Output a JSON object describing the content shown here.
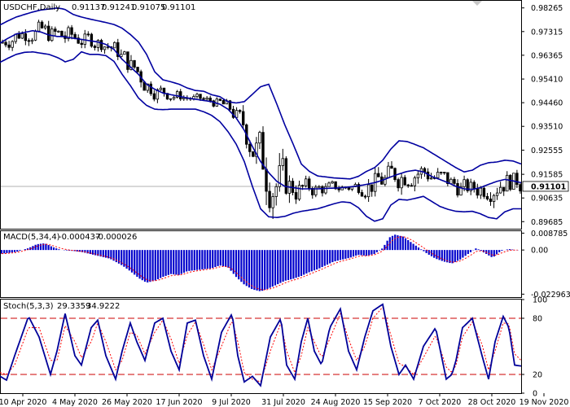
{
  "chart_data": {
    "type": "candlestick",
    "symbol_header": "USDCHF,Daily",
    "ohlc_header": [
      "0.91137",
      "0.91241",
      "0.91075",
      "0.91101"
    ],
    "current_price": "0.91101",
    "price_axis": {
      "ticks": [
        "0.98265",
        "0.97315",
        "0.96365",
        "0.95410",
        "0.94460",
        "0.93510",
        "0.92555",
        "0.91585",
        "0.90635",
        "0.89685"
      ],
      "ylim": [
        0.894,
        0.9855
      ]
    },
    "x_tick_labels": [
      "10 Apr 2020",
      "4 May 2020",
      "26 May 2020",
      "17 Jun 2020",
      "9 Jul 2020",
      "31 Jul 2020",
      "24 Aug 2020",
      "15 Sep 2020",
      "7 Oct 2020",
      "28 Oct 2020",
      "19 Nov 2020"
    ],
    "bollinger_anchors": {
      "x": [
        0,
        10,
        20,
        30,
        40,
        50,
        60,
        70,
        75,
        80,
        90,
        100,
        110,
        120,
        130,
        140,
        150,
        160,
        170,
        180,
        190,
        200,
        210,
        220,
        230,
        240,
        250,
        260,
        270,
        280,
        290,
        300,
        310,
        320,
        330,
        340,
        350,
        360,
        370,
        380,
        390,
        400,
        410,
        420,
        430,
        440,
        450,
        460,
        470,
        480,
        490,
        500,
        510,
        520,
        530,
        540,
        550,
        560,
        570,
        580,
        590,
        600,
        610,
        620,
        630,
        640
      ],
      "middle": [
        0.9685,
        0.9705,
        0.9722,
        0.9728,
        0.9735,
        0.973,
        0.9718,
        0.9712,
        0.9712,
        0.971,
        0.9705,
        0.97,
        0.9695,
        0.969,
        0.968,
        0.966,
        0.962,
        0.959,
        0.956,
        0.952,
        0.95,
        0.9485,
        0.9478,
        0.9472,
        0.9465,
        0.946,
        0.9455,
        0.945,
        0.944,
        0.942,
        0.9385,
        0.9335,
        0.927,
        0.921,
        0.9165,
        0.913,
        0.911,
        0.9105,
        0.91,
        0.91,
        0.91,
        0.9102,
        0.9103,
        0.9105,
        0.9108,
        0.9112,
        0.9118,
        0.9125,
        0.9135,
        0.9148,
        0.916,
        0.917,
        0.9175,
        0.9168,
        0.915,
        0.9138,
        0.9125,
        0.911,
        0.91,
        0.9098,
        0.9105,
        0.9118,
        0.913,
        0.9138,
        0.9132,
        0.9125
      ],
      "upper": [
        0.9758,
        0.9775,
        0.979,
        0.98,
        0.981,
        0.9818,
        0.9822,
        0.9826,
        0.9824,
        0.982,
        0.98,
        0.979,
        0.9782,
        0.9775,
        0.9768,
        0.976,
        0.9745,
        0.972,
        0.969,
        0.964,
        0.957,
        0.9538,
        0.953,
        0.952,
        0.9505,
        0.9495,
        0.9492,
        0.9478,
        0.947,
        0.945,
        0.9445,
        0.945,
        0.948,
        0.951,
        0.952,
        0.944,
        0.9355,
        0.928,
        0.92,
        0.917,
        0.9152,
        0.9148,
        0.9144,
        0.9142,
        0.914,
        0.915,
        0.917,
        0.9185,
        0.9215,
        0.926,
        0.9293,
        0.929,
        0.9278,
        0.9265,
        0.9245,
        0.9225,
        0.9205,
        0.9185,
        0.9168,
        0.9175,
        0.9195,
        0.9205,
        0.9208,
        0.9215,
        0.9212,
        0.92
      ],
      "lower": [
        0.9608,
        0.9625,
        0.964,
        0.9648,
        0.965,
        0.9645,
        0.964,
        0.9628,
        0.962,
        0.961,
        0.962,
        0.965,
        0.964,
        0.964,
        0.9635,
        0.9612,
        0.956,
        0.9515,
        0.9465,
        0.9435,
        0.942,
        0.9418,
        0.942,
        0.942,
        0.942,
        0.942,
        0.941,
        0.9395,
        0.937,
        0.933,
        0.928,
        0.921,
        0.911,
        0.902,
        0.8988,
        0.8985,
        0.899,
        0.9002,
        0.901,
        0.9015,
        0.902,
        0.903,
        0.904,
        0.9048,
        0.9045,
        0.9025,
        0.899,
        0.897,
        0.898,
        0.9035,
        0.9058,
        0.9055,
        0.9062,
        0.907,
        0.905,
        0.903,
        0.9018,
        0.901,
        0.9008,
        0.901,
        0.9,
        0.8985,
        0.898,
        0.9008,
        0.902,
        0.902
      ]
    },
    "macd": {
      "label": "MACD(5,34,4)",
      "main_value": "-0.000437",
      "signal_value": "-0.000026",
      "ticks": [
        "0.008785",
        "0.00",
        "-0.022963"
      ],
      "ylim": [
        -0.0245,
        0.0098
      ],
      "anchors_x": [
        0,
        20,
        35,
        45,
        55,
        65,
        75,
        90,
        100,
        110,
        120,
        135,
        150,
        160,
        170,
        180,
        190,
        200,
        210,
        220,
        230,
        240,
        250,
        260,
        270,
        280,
        290,
        300,
        310,
        320,
        330,
        340,
        350,
        360,
        370,
        380,
        390,
        400,
        410,
        420,
        430,
        440,
        450,
        460,
        470,
        478,
        485,
        495,
        505,
        515,
        525,
        535,
        545,
        555,
        565,
        575,
        585,
        595,
        605,
        615,
        625,
        640
      ],
      "anchors_y": [
        -0.002,
        -0.001,
        0.001,
        0.003,
        0.0035,
        0.0015,
        0.0,
        -0.0005,
        -0.001,
        -0.002,
        -0.003,
        -0.0045,
        -0.008,
        -0.011,
        -0.0145,
        -0.017,
        -0.016,
        -0.014,
        -0.0125,
        -0.013,
        -0.011,
        -0.0105,
        -0.01,
        -0.0095,
        -0.008,
        -0.009,
        -0.014,
        -0.018,
        -0.0205,
        -0.0215,
        -0.02,
        -0.018,
        -0.016,
        -0.015,
        -0.0135,
        -0.0115,
        -0.01,
        -0.008,
        -0.006,
        -0.005,
        -0.004,
        -0.0025,
        -0.003,
        -0.002,
        0.001,
        0.0065,
        0.008,
        0.007,
        0.004,
        0.001,
        -0.002,
        -0.0045,
        -0.006,
        -0.007,
        -0.005,
        -0.002,
        0.001,
        -0.0015,
        -0.004,
        -0.0005,
        0.0005,
        -0.0004
      ]
    },
    "stoch": {
      "label": "Stoch(5,3,3)",
      "main_value": "29.3359",
      "signal_value": "34.9222",
      "ticks": [
        "100",
        "80",
        "20",
        "0"
      ],
      "levels": [
        80,
        20
      ],
      "ylim": [
        0,
        100
      ],
      "anchors_x": [
        0,
        8,
        18,
        35,
        48,
        62,
        70,
        80,
        92,
        100,
        112,
        120,
        130,
        142,
        150,
        160,
        168,
        178,
        190,
        200,
        210,
        220,
        230,
        240,
        250,
        260,
        272,
        285,
        292,
        300,
        310,
        320,
        332,
        345,
        352,
        362,
        370,
        378,
        386,
        395,
        405,
        418,
        428,
        438,
        448,
        458,
        470,
        480,
        490,
        498,
        508,
        520,
        535,
        548,
        555,
        560,
        568,
        580,
        592,
        600,
        608,
        618,
        625,
        632,
        640
      ],
      "anchors_k": [
        18,
        14,
        40,
        82,
        60,
        20,
        45,
        85,
        40,
        30,
        70,
        78,
        40,
        15,
        45,
        75,
        55,
        35,
        75,
        80,
        45,
        25,
        75,
        78,
        40,
        15,
        65,
        85,
        40,
        12,
        18,
        8,
        60,
        80,
        30,
        15,
        55,
        80,
        45,
        30,
        70,
        90,
        45,
        25,
        60,
        88,
        95,
        50,
        20,
        30,
        15,
        50,
        70,
        15,
        20,
        35,
        70,
        80,
        40,
        15,
        55,
        82,
        70,
        30,
        29
      ],
      "anchors_d": [
        22,
        20,
        30,
        70,
        70,
        35,
        35,
        72,
        55,
        38,
        55,
        75,
        55,
        25,
        35,
        65,
        62,
        42,
        65,
        78,
        58,
        32,
        62,
        76,
        52,
        25,
        50,
        78,
        55,
        22,
        15,
        12,
        45,
        75,
        45,
        22,
        40,
        70,
        55,
        38,
        58,
        85,
        58,
        35,
        50,
        80,
        92,
        62,
        32,
        28,
        20,
        38,
        62,
        28,
        22,
        30,
        60,
        76,
        52,
        25,
        45,
        75,
        74,
        42,
        35
      ]
    }
  }
}
